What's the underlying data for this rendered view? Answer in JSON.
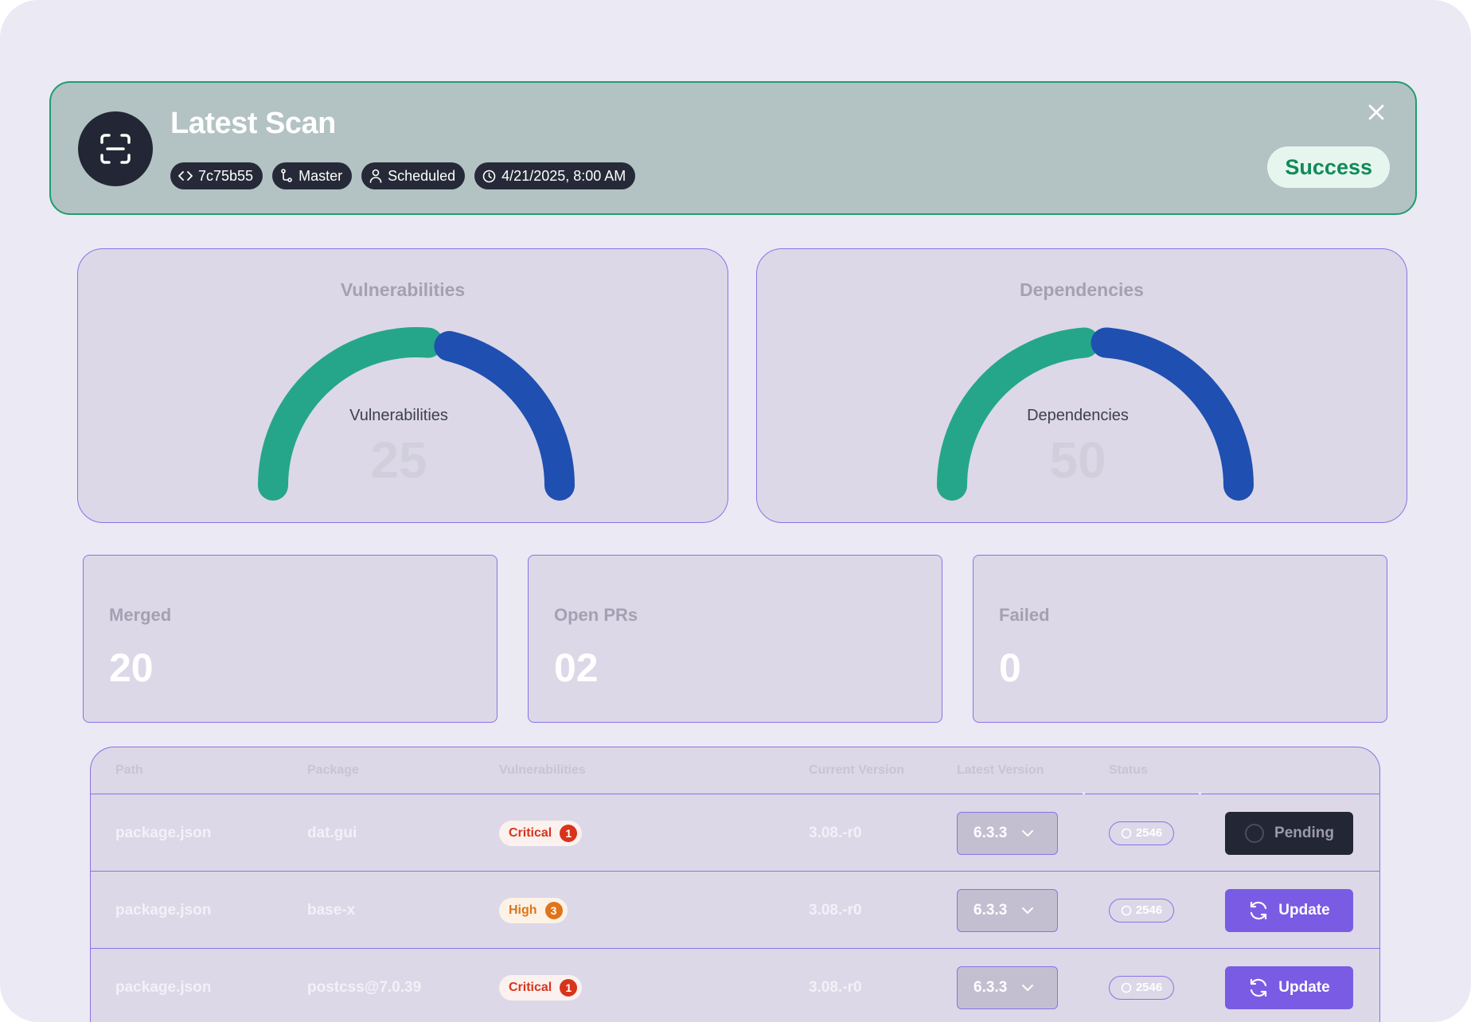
{
  "banner": {
    "title": "Latest Scan",
    "chips": [
      {
        "icon": "code-icon",
        "label": "7c75b55"
      },
      {
        "icon": "git-branch-icon",
        "label": "Master"
      },
      {
        "icon": "user-icon",
        "label": "Scheduled"
      },
      {
        "icon": "clock-icon",
        "label": "4/21/2025, 8:00 AM"
      }
    ],
    "status": "Success",
    "close_icon": "close-icon"
  },
  "gauges": [
    {
      "title": "Vulnerabilities",
      "label": "Vulnerabilities",
      "value": "25",
      "fraction": 0.55,
      "primary_color": "#25a68a",
      "secondary_color": "#1f4fb0"
    },
    {
      "title": "Dependencies",
      "label": "Dependencies",
      "value": "50",
      "fraction": 0.5,
      "primary_color": "#25a68a",
      "secondary_color": "#1f4fb0"
    }
  ],
  "stats": [
    {
      "label": "Merged",
      "value": "20"
    },
    {
      "label": "Open PRs",
      "value": "02"
    },
    {
      "label": "Failed",
      "value": "0"
    }
  ],
  "table": {
    "headers": [
      "Path",
      "Package",
      "Vulnerabilities",
      "Current Version",
      "Latest Version",
      "Status"
    ],
    "rows": [
      {
        "path": "package.json",
        "package": "dat.gui",
        "severity": "Critical",
        "severity_count": "1",
        "current": "3.08.-r0",
        "latest": "6.3.3",
        "status": "2546",
        "action": "Pending"
      },
      {
        "path": "package.json",
        "package": "base-x",
        "severity": "High",
        "severity_count": "3",
        "current": "3.08.-r0",
        "latest": "6.3.3",
        "status": "2546",
        "action": "Update"
      },
      {
        "path": "package.json",
        "package": "postcss@7.0.39",
        "severity": "Critical",
        "severity_count": "1",
        "current": "3.08.-r0",
        "latest": "6.3.3",
        "status": "2546",
        "action": "Update"
      }
    ]
  }
}
